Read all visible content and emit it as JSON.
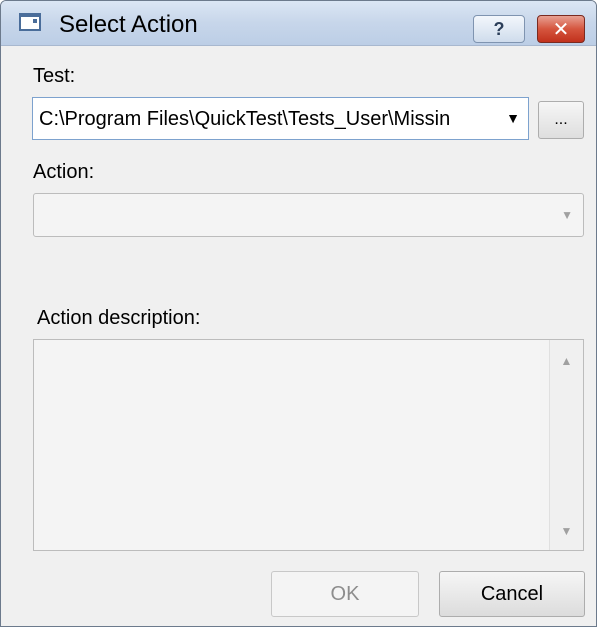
{
  "window": {
    "title": "Select Action",
    "help_label": "?",
    "close_label": "✕",
    "icon": "application-window-icon"
  },
  "test": {
    "label": "Test:",
    "value": "C:\\Program Files\\QuickTest\\Tests_User\\Missin",
    "dropdown_arrow": "▼",
    "browse_label": "..."
  },
  "action": {
    "label": "Action:",
    "value": "",
    "dropdown_arrow": "▼"
  },
  "description": {
    "label": "Action description:",
    "value": "",
    "scroll_up": "▲",
    "scroll_down": "▼"
  },
  "buttons": {
    "ok": "OK",
    "cancel": "Cancel"
  }
}
